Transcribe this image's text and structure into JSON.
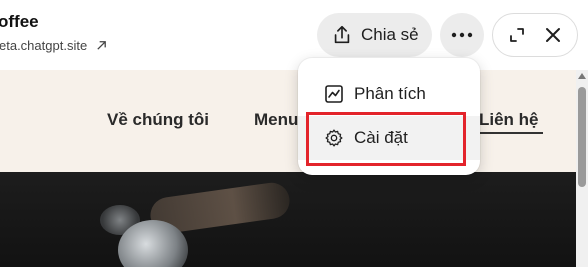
{
  "header": {
    "title": "offee",
    "url": "eta.chatgpt.site"
  },
  "toolbar": {
    "share_label": "Chia sẻ"
  },
  "site_nav": {
    "about": "Về chúng tôi",
    "menu": "Menu",
    "contact": "Liên hệ"
  },
  "dropdown": {
    "items": [
      {
        "label": "Phân tích",
        "icon": "chart-icon"
      },
      {
        "label": "Cài đặt",
        "icon": "gear-icon"
      }
    ]
  },
  "colors": {
    "highlight": "#e3242b",
    "nav_background": "#f7f1ea",
    "button_background": "#ececec"
  }
}
